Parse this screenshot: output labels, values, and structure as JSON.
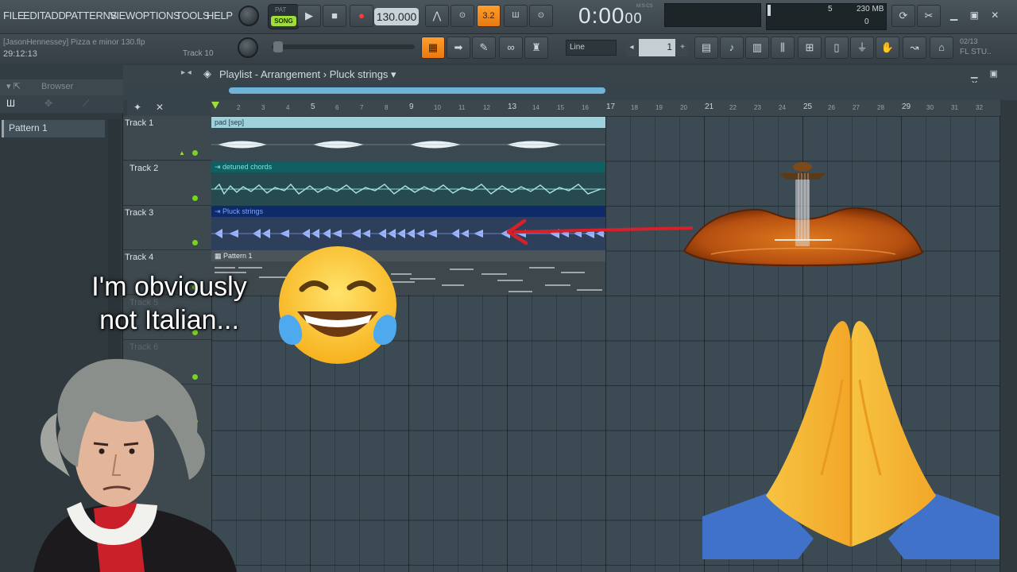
{
  "menu": [
    "FILE",
    "EDIT",
    "ADD",
    "PATTERNS",
    "VIEW",
    "OPTIONS",
    "TOOLS",
    "HELP"
  ],
  "transport": {
    "mode_pat": "PAT",
    "mode_song": "SONG",
    "tempo": "130.000",
    "time": "0:00",
    "time_small": "00",
    "time_unit": "M:S:CS",
    "cpu": "5",
    "memory": "230 MB",
    "voices": "0"
  },
  "hint": {
    "project": "[JasonHennessey] Pizza e minor 130.flp",
    "time": "29:12:13",
    "track": "Track 10",
    "snap": "Line",
    "step": "1",
    "fl_studio": "FL STU..",
    "date": "02/13"
  },
  "browser": {
    "title": "Browser",
    "items": [
      "Pattern 1"
    ]
  },
  "playlist": {
    "title": "Playlist - Arrangement",
    "current_pattern": "Pluck strings",
    "ruler": [
      "2",
      "3",
      "4",
      "5",
      "6",
      "7",
      "8",
      "9",
      "10",
      "11",
      "12",
      "13",
      "14",
      "15",
      "16",
      "17",
      "18",
      "19",
      "20",
      "21",
      "22",
      "23",
      "24",
      "25",
      "26",
      "27",
      "28",
      "29",
      "30",
      "31",
      "32"
    ],
    "tracks": [
      "Track 1",
      "Track 2",
      "Track 3",
      "Track 4",
      "Track 5",
      "Track 6"
    ],
    "clips": [
      "pad [sep]",
      "detuned chords",
      "Pluck strings",
      "Pattern 1"
    ]
  },
  "overlay": {
    "caption_line1": "I'm obviously",
    "caption_line2": "not Italian..."
  },
  "colors": {
    "accent_orange": "#f4891a",
    "song_green": "#9edd3a",
    "pad_clip": "#9fd1dd",
    "chords_clip": "#0f5f63",
    "pluck_clip": "#0e2a68",
    "arrow_red": "#d8202a"
  }
}
